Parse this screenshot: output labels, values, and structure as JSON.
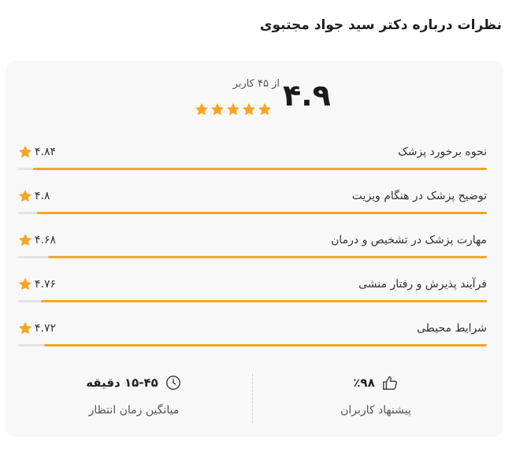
{
  "section_title": "نظرات درباره دکتر سید جواد مجتبوی",
  "summary": {
    "score": "۴.۹",
    "count_text": "از ۴۵ کاربر",
    "stars": 5
  },
  "criteria": [
    {
      "label": "نحوه برخورد پزشک",
      "value": "۴.۸۴",
      "fraction": 0.968
    },
    {
      "label": "توضیح پزشک در هنگام ویزیت",
      "value": "۴.۸",
      "fraction": 0.96
    },
    {
      "label": "مهارت پزشک در تشخیص و درمان",
      "value": "۴.۶۸",
      "fraction": 0.936
    },
    {
      "label": "فرآیند پذیرش و رفتار منشی",
      "value": "۴.۷۶",
      "fraction": 0.952
    },
    {
      "label": "شرایط محیطی",
      "value": "۴.۷۲",
      "fraction": 0.944
    }
  ],
  "stats": {
    "wait": {
      "value": "۱۵-۴۵ دقیقه",
      "label": "میانگین زمان انتظار",
      "icon": "clock-icon"
    },
    "recommend": {
      "value": "٪۹۸",
      "label": "پیشنهاد کاربران",
      "icon": "thumbs-up-icon"
    }
  },
  "colors": {
    "accent": "#f5a623",
    "track": "#e3e3e3",
    "card": "#f8f8f8"
  }
}
